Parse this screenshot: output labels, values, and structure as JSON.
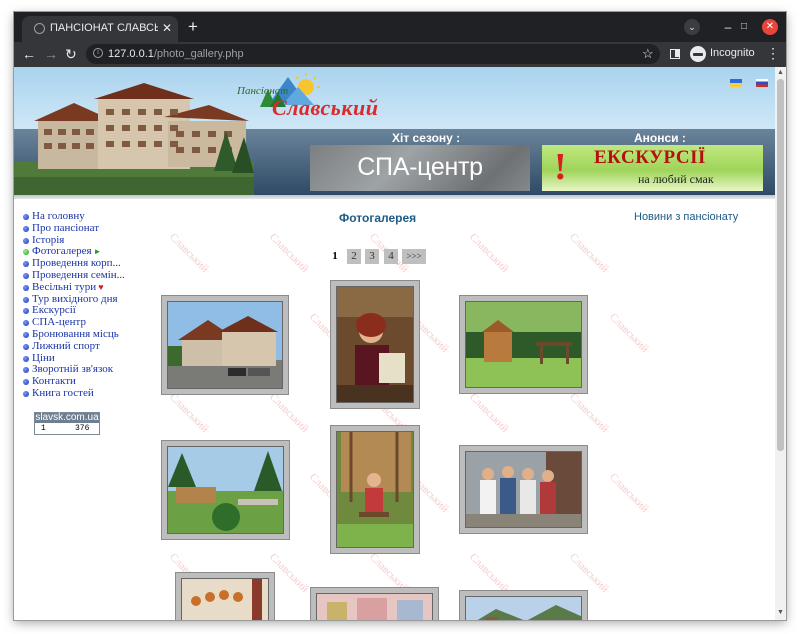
{
  "browser": {
    "tab_title": "ПАНСІОНАТ СЛАВСЬКИЙ",
    "tab_close": "✕",
    "new_tab": "+",
    "url_host": "127.0.0.1",
    "url_path": "/photo_gallery.php",
    "profile_label": "Incognito"
  },
  "header": {
    "logo_small": "Пансіонат",
    "logo_big": "Славський",
    "hit_label": "Хіт сезону :",
    "announce_label": "Анонси :",
    "spa_banner": "СПА-центр",
    "excursion_title": "ЕКСКУРСІЇ",
    "excursion_sub": "на любий смак",
    "excursion_bang": "!"
  },
  "menu": [
    {
      "label": "На головну"
    },
    {
      "label": "Про пансіонат"
    },
    {
      "label": "Історія"
    },
    {
      "label": "Фотогалерея",
      "marker": "►"
    },
    {
      "label": "Проведення корп..."
    },
    {
      "label": "Проведення семін..."
    },
    {
      "label": "Весільні тури",
      "marker": "♥"
    },
    {
      "label": "Тур вихідного дня"
    },
    {
      "label": "Екскурсії"
    },
    {
      "label": "СПА-центр"
    },
    {
      "label": "Бронювання місць"
    },
    {
      "label": "Лижний спорт"
    },
    {
      "label": "Ціни"
    },
    {
      "label": "Зворотній зв'язок"
    },
    {
      "label": "Контакти"
    },
    {
      "label": "Книга гостей"
    }
  ],
  "counter": {
    "site": "slavsk.com.ua",
    "left": "1",
    "right": "376"
  },
  "main": {
    "title": "Фотогалерея",
    "news_link": "Новини з пансіонату",
    "pager": {
      "current": "1",
      "pages": [
        "2",
        "3",
        "4"
      ],
      "next": ">>>"
    }
  },
  "watermark_text": "Славський",
  "colors": {
    "link": "#1b34a8",
    "heading": "#1c5b88",
    "watermark": "#f3cfcf"
  }
}
